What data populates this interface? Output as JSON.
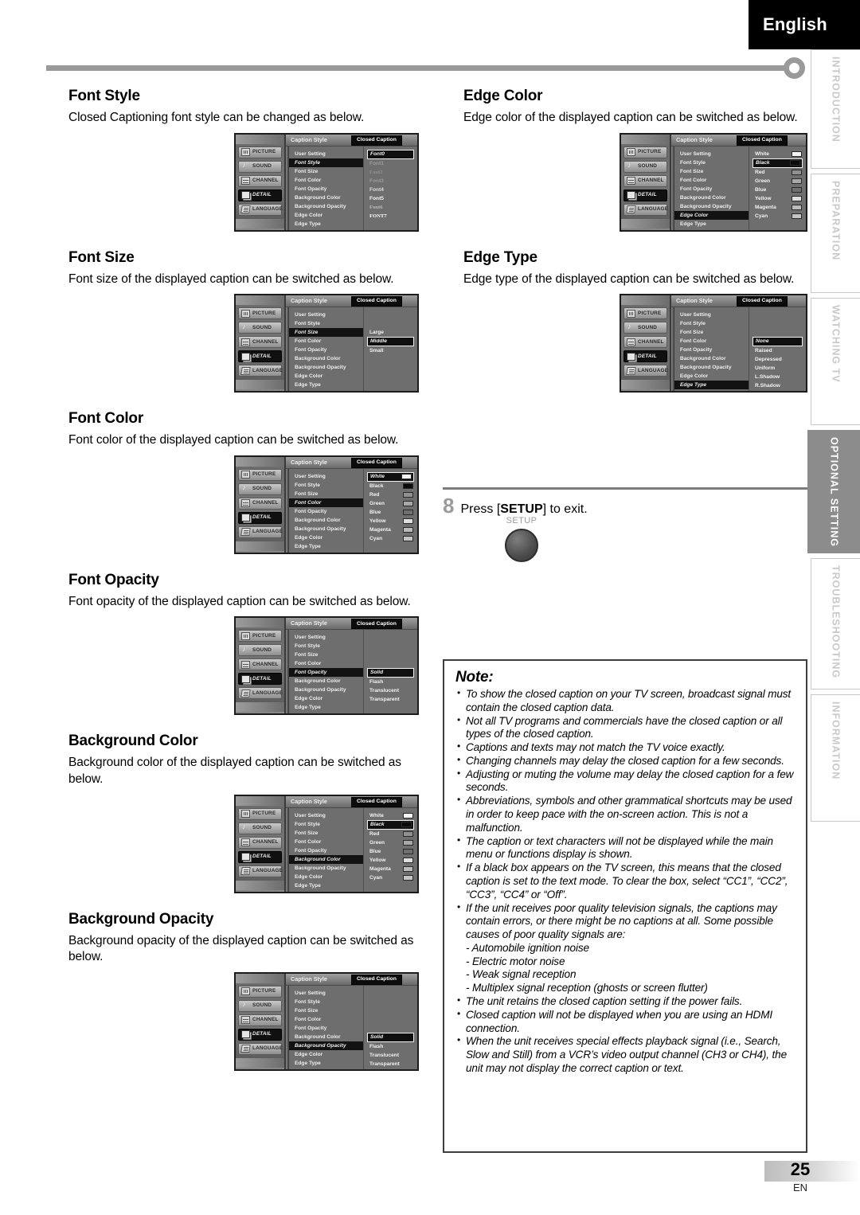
{
  "header": {
    "language_tab": "English"
  },
  "rail": {
    "tabs": [
      {
        "label": "INTRODUCTION",
        "active": false
      },
      {
        "label": "PREPARATION",
        "active": false
      },
      {
        "label": "WATCHING TV",
        "active": false
      },
      {
        "label": "OPTIONAL SETTING",
        "active": true
      },
      {
        "label": "TROUBLESHOOTING",
        "active": false
      },
      {
        "label": "INFORMATION",
        "active": false
      }
    ]
  },
  "osd_common": {
    "title": "Caption Style",
    "chip": "Closed Caption",
    "side_menu": [
      "PICTURE",
      "SOUND",
      "CHANNEL",
      "DETAIL",
      "LANGUAGE"
    ],
    "side_menu_selected": "DETAIL",
    "items": [
      "User Setting",
      "Font Style",
      "Font Size",
      "Font Color",
      "Font Opacity",
      "Background Color",
      "Background Opacity",
      "Edge Color",
      "Edge Type"
    ]
  },
  "sections": {
    "font_style": {
      "heading": "Font Style",
      "body": "Closed Captioning font style can be changed as below.",
      "highlight": "Font Style",
      "values": [
        "Font0",
        "Font1",
        "Font2",
        "Font3",
        "Font4",
        "Font5",
        "Font6",
        "FONT7"
      ],
      "selected": "Font0"
    },
    "font_size": {
      "heading": "Font Size",
      "body": "Font size of the displayed caption can be switched as below.",
      "highlight": "Font Size",
      "values": [
        "Large",
        "Middle",
        "Small"
      ],
      "selected": "Middle"
    },
    "font_color": {
      "heading": "Font Color",
      "body": "Font color of the displayed caption can be switched as below.",
      "highlight": "Font Color",
      "values": [
        "White",
        "Black",
        "Red",
        "Green",
        "Blue",
        "Yellow",
        "Magenta",
        "Cyan"
      ],
      "selected": "White"
    },
    "font_opacity": {
      "heading": "Font Opacity",
      "body": "Font opacity of the displayed caption can be switched as below.",
      "highlight": "Font Opacity",
      "values": [
        "Solid",
        "Flash",
        "Translucent",
        "Transparent"
      ],
      "selected": "Solid"
    },
    "background_color": {
      "heading": "Background Color",
      "body": "Background color of the displayed caption can be switched as below.",
      "highlight": "Background Color",
      "values": [
        "White",
        "Black",
        "Red",
        "Green",
        "Blue",
        "Yellow",
        "Magenta",
        "Cyan"
      ],
      "selected": "Black"
    },
    "background_opacity": {
      "heading": "Background Opacity",
      "body": "Background opacity of the displayed caption can be switched as below.",
      "highlight": "Background Opacity",
      "values": [
        "Solid",
        "Flash",
        "Translucent",
        "Transparent"
      ],
      "selected": "Solid"
    },
    "edge_color": {
      "heading": "Edge Color",
      "body": "Edge color of the displayed caption can be switched as below.",
      "highlight": "Edge Color",
      "values": [
        "White",
        "Black",
        "Red",
        "Green",
        "Blue",
        "Yellow",
        "Magenta",
        "Cyan"
      ],
      "selected": "Black"
    },
    "edge_type": {
      "heading": "Edge Type",
      "body": "Edge type of the displayed caption can be switched as below.",
      "highlight": "Edge Type",
      "values": [
        "None",
        "Raised",
        "Depressed",
        "Uniform",
        "L.Shadow",
        "R.Shadow"
      ],
      "selected": "None"
    }
  },
  "step": {
    "number": "8",
    "text_before": "Press [",
    "text_key": "SETUP",
    "text_after": "] to exit.",
    "button_label": "SETUP"
  },
  "note": {
    "title": "Note:",
    "items": [
      "To show the closed caption on your TV screen, broadcast signal must contain the closed caption data.",
      "Not all TV programs and commercials have the closed caption or all types of the closed caption.",
      "Captions and texts may not match the TV voice exactly.",
      "Changing channels may delay the closed caption for a few seconds.",
      "Adjusting or muting the volume may delay the closed caption for a few seconds.",
      "Abbreviations, symbols and other grammatical shortcuts may be used in order to keep pace with the on-screen action. This is not a malfunction.",
      "The caption or text characters will not be displayed while the main menu or functions display is shown.",
      "If a black box appears on the TV screen, this means that the closed caption is set to the text mode. To clear the box, select “CC1”, “CC2”, “CC3”, “CC4” or “Off”.",
      "If the unit receives poor quality television signals, the captions may contain errors, or there might be no captions at all. Some possible causes of poor quality signals are:",
      "The unit retains the closed caption setting if the power fails.",
      "Closed caption will not be displayed when you are using an HDMI connection.",
      "When the unit receives special effects playback signal (i.e., Search, Slow and Still) from a VCR’s video output channel (CH3 or CH4), the unit may not display the correct caption or text."
    ],
    "sublist": [
      "- Automobile ignition noise",
      "- Electric motor noise",
      "- Weak signal reception",
      "- Multiplex signal reception (ghosts or screen flutter)"
    ]
  },
  "footer": {
    "page_number": "25",
    "page_code": "EN"
  },
  "colors": {
    "swatch_white": "#f4f4f4",
    "swatch_black": "#0b0b0b",
    "swatch_red": "#909090",
    "swatch_green": "#a8a8a8",
    "swatch_blue": "#6f6f6f",
    "swatch_yellow": "#dedede",
    "swatch_magenta": "#bcbcbc",
    "swatch_cyan": "#c4c4c4"
  }
}
